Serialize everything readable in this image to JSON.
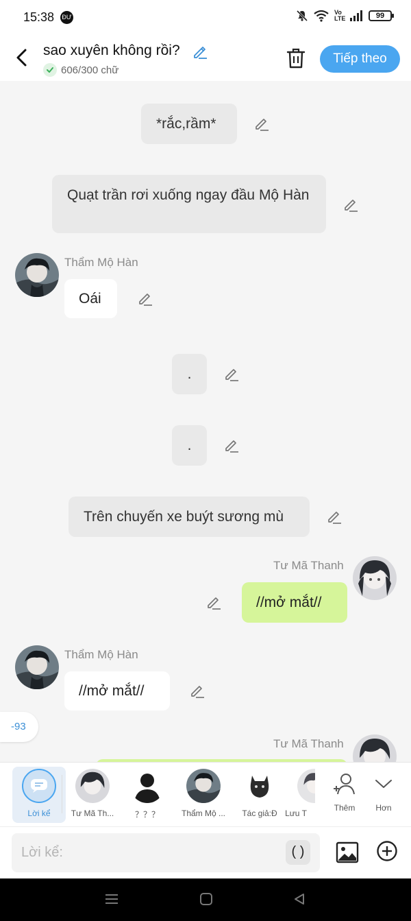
{
  "status_bar": {
    "time": "15:38",
    "notification_badge": "ĐƯ",
    "network_label": "Vo LTE",
    "battery": "99"
  },
  "header": {
    "title": "sao xuyên không rồi?",
    "word_count": "606/300 chữ",
    "next_label": "Tiếp theo"
  },
  "messages": {
    "narration_1": "*rắc,rầm*",
    "narration_2": "Quạt trần rơi xuống ngay đầu Mộ Hàn",
    "speaker_1": "Thẩm Mộ Hàn",
    "msg_1": "Oái",
    "narration_3": ".",
    "narration_4": ".",
    "narration_5": "Trên chuyến xe buýt sương mù",
    "speaker_2": "Tư Mã Thanh",
    "msg_2": "//mở mắt//",
    "speaker_3": "Thẩm Mộ Hàn",
    "msg_3": "//mở mắt//",
    "badge": "-93",
    "speaker_4": "Tư Mã Thanh"
  },
  "characters": [
    {
      "label": "Lời kể"
    },
    {
      "label": "Tư Mã Th..."
    },
    {
      "label": "？？？"
    },
    {
      "label": "Thẩm Mộ ..."
    },
    {
      "label": "Tác giả:Đ"
    },
    {
      "label": "Lưu T"
    },
    {
      "label": "Thêm"
    },
    {
      "label": "Hơn"
    }
  ],
  "input": {
    "placeholder": "Lời kể:",
    "paren_label": "( )"
  },
  "colors": {
    "accent": "#4aa6f0",
    "right_bubble": "#d6f59a",
    "narration_bubble": "#e9e9e9",
    "background": "#f5f5f5"
  }
}
